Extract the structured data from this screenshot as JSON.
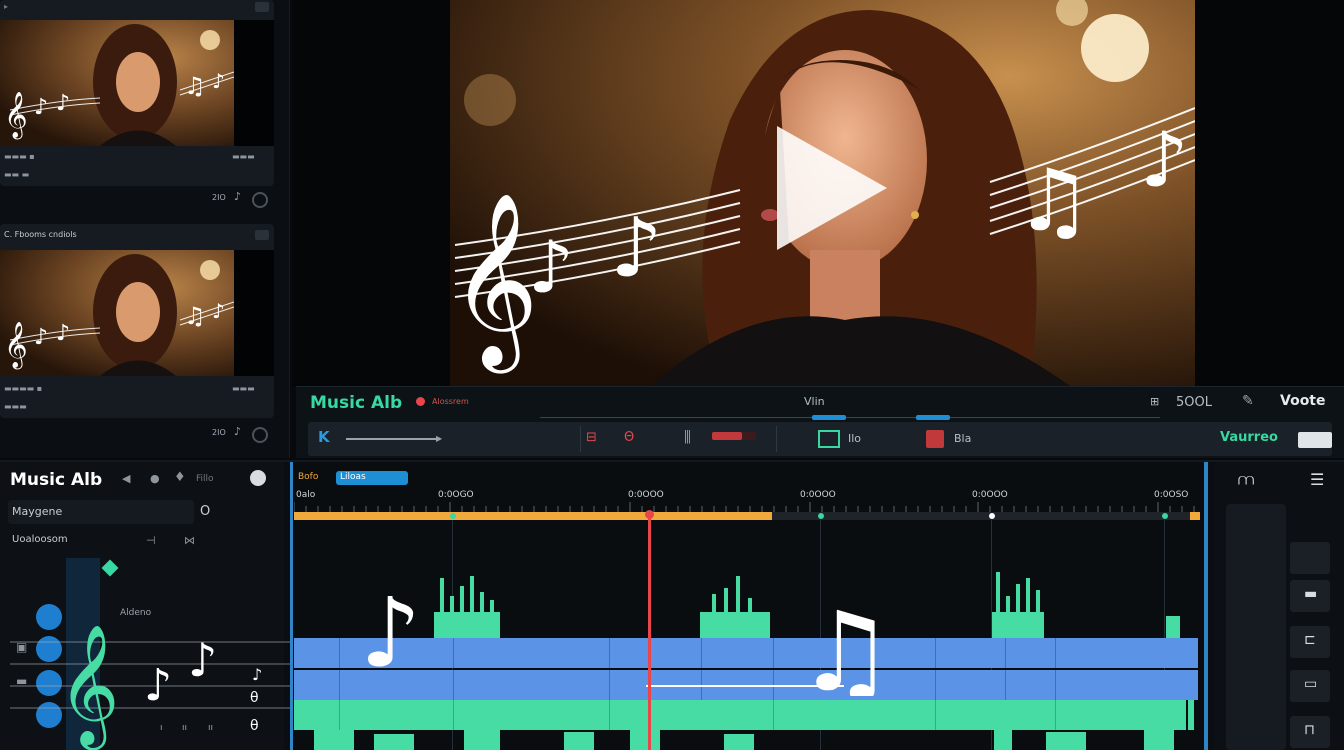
{
  "colors": {
    "accent_green": "#37d8a2",
    "clip_blue": "#5b93e6",
    "playhead_red": "#e8464a",
    "progress_orange": "#f2a93b",
    "badge_blue": "#1e8fd4"
  },
  "media_panel": {
    "clips": [
      {
        "header": "",
        "thumb_date": "",
        "thumb_meta": ""
      },
      {
        "header": "C. Fbooms cndiols",
        "thumb_date": "",
        "thumb_meta": ""
      }
    ],
    "clip_time": "2IO"
  },
  "audio_bar": {
    "title": "Music Alb",
    "rec_label": "Alossrem",
    "mid_label": "Vlin",
    "zoom_value": "5OOL",
    "volume_label": "Voote",
    "sub_items": [
      "Ilo",
      "Bla"
    ],
    "mode_label": "Vaurreo"
  },
  "bottom_left": {
    "title": "Music Alb",
    "filter_label": "Fillo",
    "field1": "Maygene",
    "field1_value": "O",
    "field2": "Uoaloosom",
    "track_label": "Aldeno"
  },
  "timeline": {
    "top_badge": "Liloas",
    "top_small": "Bofo",
    "ruler": [
      "0alo",
      "0:0OGO",
      "0:0OOO",
      "0:0OOO",
      "0:0OOO",
      "0:0OSO"
    ],
    "progress_fraction": 0.528,
    "playhead_fraction": 0.391
  },
  "right_panel": {
    "icons": [
      "waveform-icon",
      "menu-icon"
    ]
  }
}
